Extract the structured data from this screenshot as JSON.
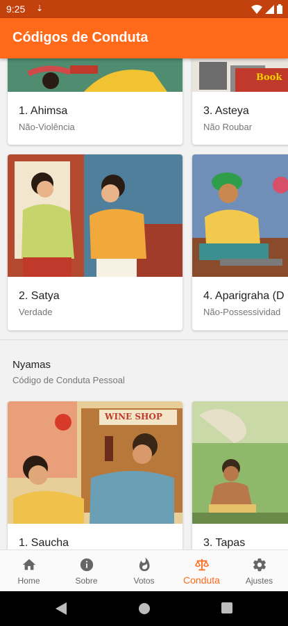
{
  "status": {
    "time": "9:25",
    "download_glyph": "⇣"
  },
  "appbar": {
    "title": "Códigos de Conduta"
  },
  "cards_top": [
    {
      "name": "1. Ahimsa",
      "sub": "Não-Violência"
    },
    {
      "name": "3. Asteya",
      "sub": "Não Roubar"
    },
    {
      "name": "2. Satya",
      "sub": "Verdade"
    },
    {
      "name": "4. Aparigraha (D",
      "sub": "Não-Possessividad"
    }
  ],
  "section": {
    "title": "Nyamas",
    "subtitle": "Código de Conduta Pessoal"
  },
  "cards_bottom": [
    {
      "name": "1. Saucha",
      "sign": "WINE SHOP"
    },
    {
      "name": "3. Tapas"
    }
  ],
  "book_sign": "Book",
  "bottom_nav": [
    {
      "label": "Home",
      "icon": "home-icon"
    },
    {
      "label": "Sobre",
      "icon": "info-icon"
    },
    {
      "label": "Votos",
      "icon": "flame-icon"
    },
    {
      "label": "Conduta",
      "icon": "scales-icon",
      "active": true
    },
    {
      "label": "Ajustes",
      "icon": "gear-icon"
    }
  ],
  "colors": {
    "accent": "#ff6a1a",
    "statusbar": "#c2410c",
    "inactive": "#666666"
  }
}
